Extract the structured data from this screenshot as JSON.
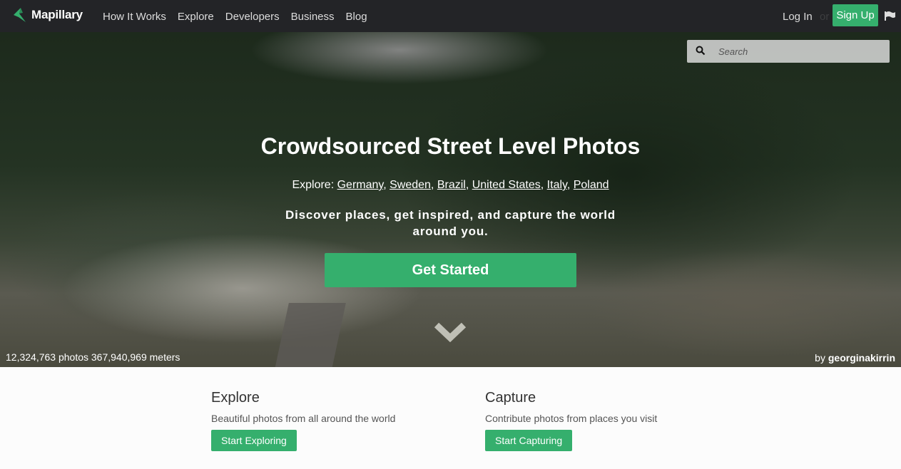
{
  "nav": {
    "brand": "Mapillary",
    "links": [
      "How It Works",
      "Explore",
      "Developers",
      "Business",
      "Blog"
    ],
    "login": "Log In",
    "or": "or",
    "signup": "Sign Up",
    "flag_icon": "flag-icon"
  },
  "search": {
    "placeholder": "Search",
    "value": ""
  },
  "hero": {
    "title": "Crowdsourced Street Level Photos",
    "explore_prefix": "Explore:",
    "countries": [
      "Germany",
      "Sweden",
      "Brazil",
      "United States",
      "Italy",
      "Poland"
    ],
    "tagline": "Discover places, get inspired, and capture the world around you.",
    "cta": "Get Started",
    "stats": "12,324,763 photos 367,940,969 meters",
    "credit_prefix": "by",
    "credit_user": "georginakirrin"
  },
  "features": [
    {
      "title": "Explore",
      "desc": "Beautiful photos from all around the world",
      "button": "Start Exploring"
    },
    {
      "title": "Capture",
      "desc": "Contribute photos from places you visit",
      "button": "Start Capturing"
    }
  ],
  "colors": {
    "accent": "#35af6d",
    "nav_bg": "#232427"
  }
}
